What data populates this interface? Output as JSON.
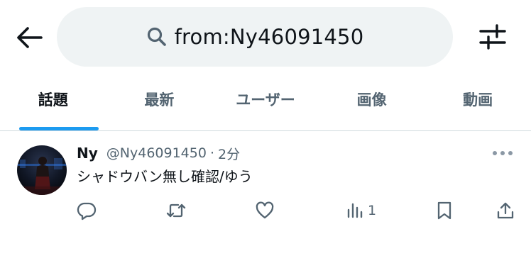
{
  "header": {
    "back_icon": "arrow-left-icon",
    "search_icon": "search-icon",
    "search_query": "from:Ny46091450",
    "filter_icon": "sliders-icon"
  },
  "tabs": [
    {
      "label": "話題",
      "active": true
    },
    {
      "label": "最新",
      "active": false
    },
    {
      "label": "ユーザー",
      "active": false
    },
    {
      "label": "画像",
      "active": false
    },
    {
      "label": "動画",
      "active": false
    }
  ],
  "tweet": {
    "name": "Ny",
    "handle": "@Ny46091450",
    "separator": "·",
    "time": "2分",
    "text": "シャドウバン無し確認/ゆう",
    "actions": {
      "reply_icon": "reply-icon",
      "retweet_icon": "retweet-icon",
      "like_icon": "heart-icon",
      "views_icon": "views-chart-icon",
      "views_count": "1",
      "bookmark_icon": "bookmark-icon",
      "share_icon": "share-icon"
    }
  },
  "colors": {
    "accent": "#1d9bf0",
    "text_primary": "#0f1419",
    "text_secondary": "#536471",
    "search_bg": "#eff3f4",
    "divider": "#cfd9de"
  }
}
